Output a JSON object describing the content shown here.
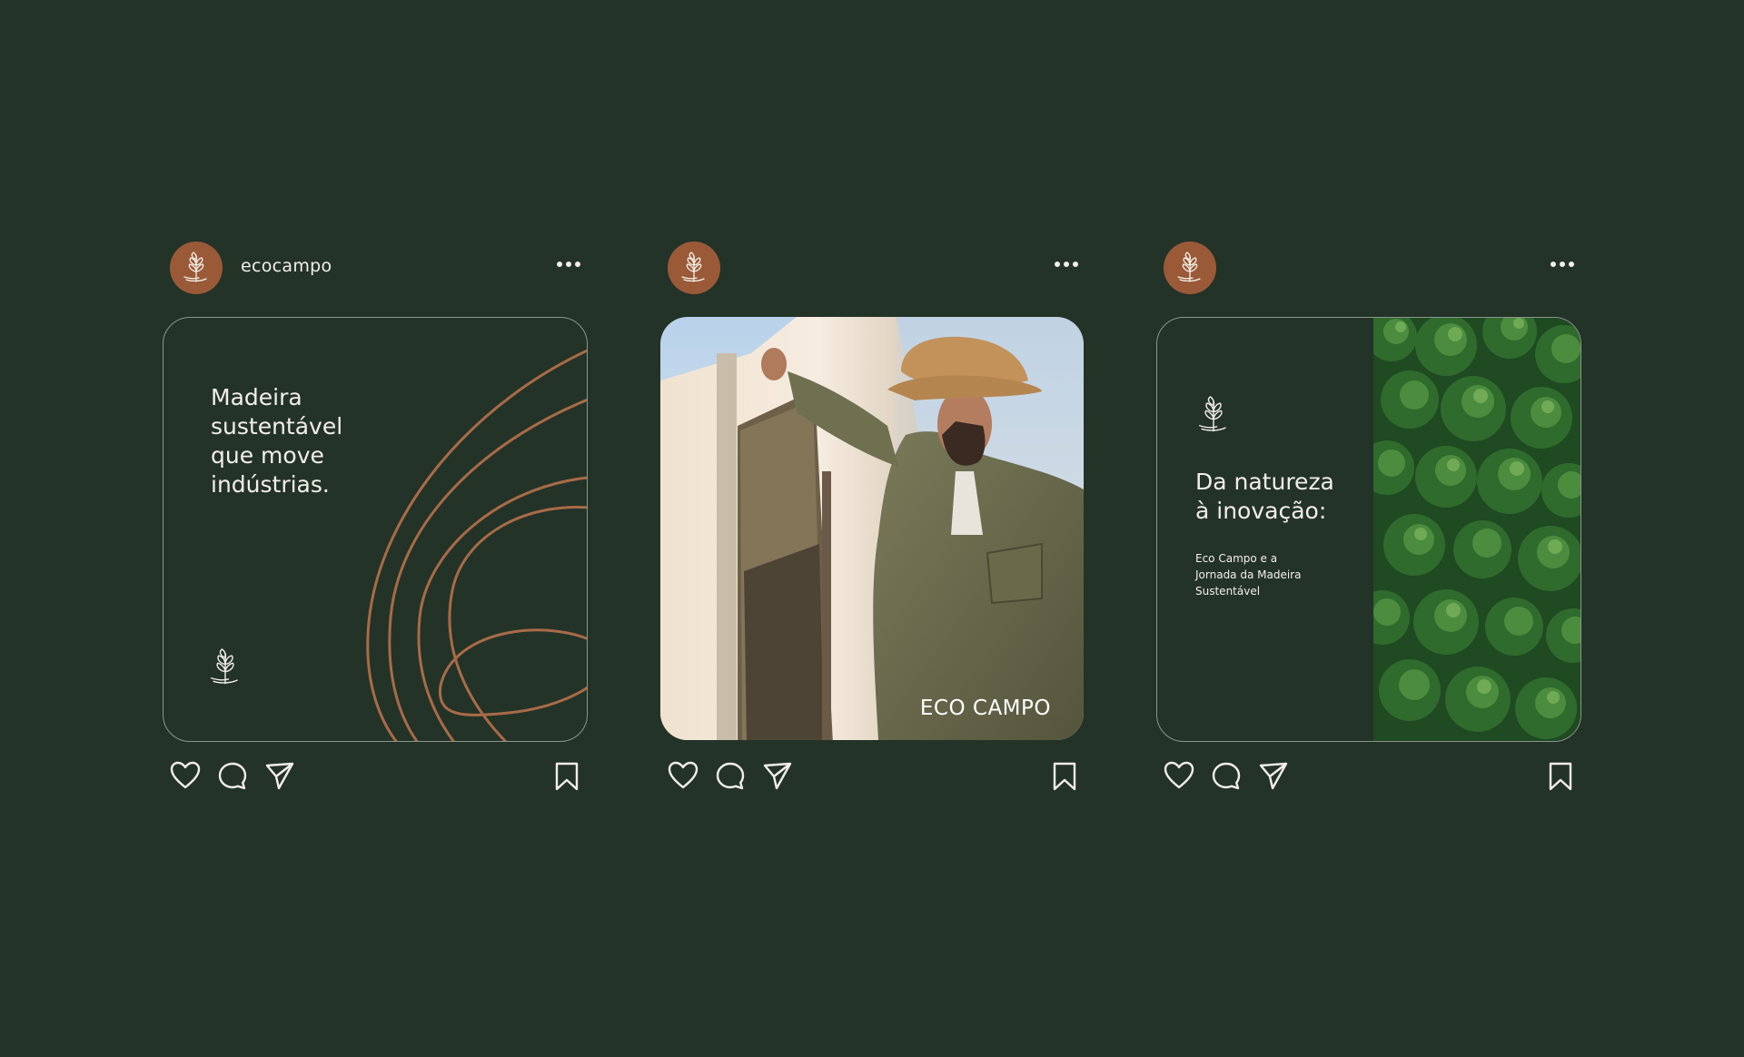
{
  "posts": [
    {
      "username": "ecocampo",
      "headline_lines": [
        "Madeira",
        "sustentável",
        "que move",
        "indústrias."
      ]
    },
    {
      "username": "",
      "watermark": "ECO CAMPO"
    },
    {
      "username": "",
      "title_lines": [
        "Da natureza",
        "à inovação:"
      ],
      "subtitle_lines": [
        "Eco Campo e a",
        "Jornada da Madeira",
        "Sustentável"
      ]
    }
  ],
  "icons": {
    "avatar": "tree-logo-icon",
    "more": "more-dots-icon",
    "like": "heart-icon",
    "comment": "comment-icon",
    "share": "send-icon",
    "save": "bookmark-icon"
  },
  "colors": {
    "background": "#243328",
    "accent": "#9a5a38",
    "text": "#f2efe8",
    "card_border": "#8a958c"
  }
}
